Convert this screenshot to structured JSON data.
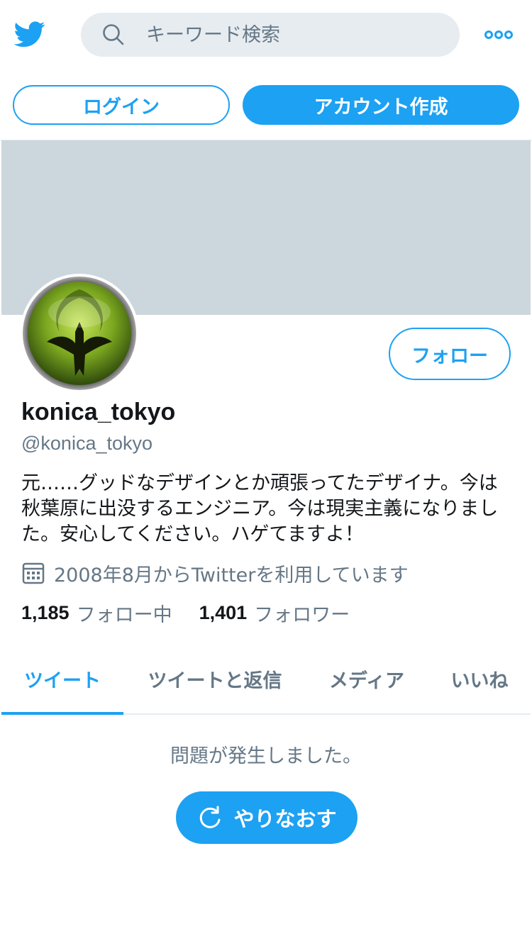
{
  "header": {
    "logo_icon": "twitter-bird-icon",
    "search": {
      "placeholder": "キーワード検索",
      "value": "",
      "icon": "search-icon"
    },
    "more_icon": "more-icon"
  },
  "auth": {
    "login_label": "ログイン",
    "signup_label": "アカウント作成"
  },
  "profile": {
    "follow_label": "フォロー",
    "display_name": "konica_tokyo",
    "handle": "@konica_tokyo",
    "bio": "元……グッドなデザインとか頑張ってたデザイナ。今は秋葉原に出没するエンジニア。今は現実主義になりました。安心してください。ハゲてますよ！",
    "joined": "2008年8月からTwitterを利用しています",
    "following_count": "1,185",
    "following_label": "フォロー中",
    "followers_count": "1,401",
    "followers_label": "フォロワー"
  },
  "tabs": [
    {
      "label": "ツイート",
      "active": true
    },
    {
      "label": "ツイートと返信",
      "active": false
    },
    {
      "label": "メディア",
      "active": false
    },
    {
      "label": "いいね",
      "active": false
    }
  ],
  "timeline": {
    "error_message": "問題が発生しました。",
    "retry_label": "やりなおす"
  },
  "colors": {
    "accent": "#1da1f2",
    "banner": "#ccd6dd",
    "secondary_text": "#657786",
    "search_bg": "#e6ecf0"
  }
}
